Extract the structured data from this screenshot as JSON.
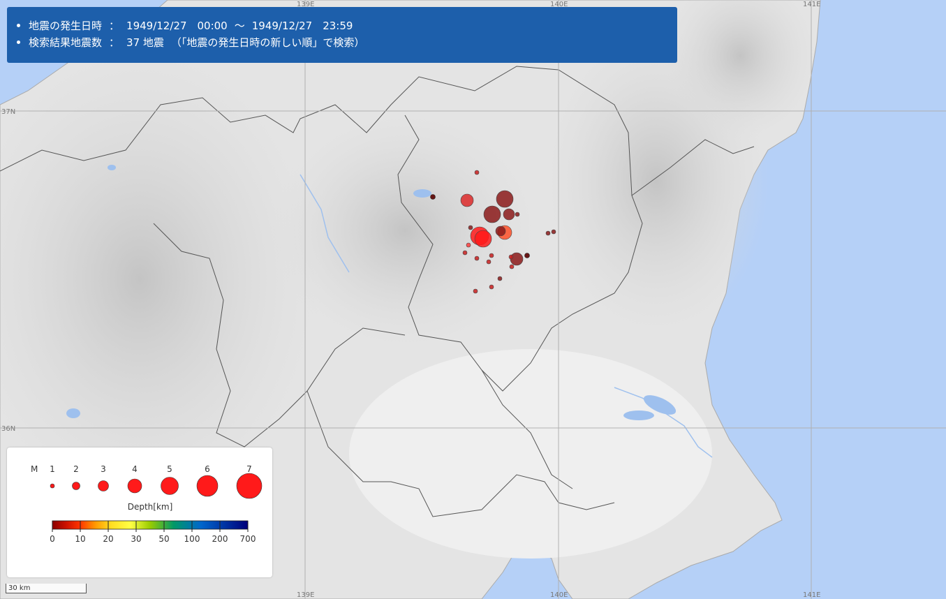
{
  "info": {
    "line1_label": "地震の発生日時",
    "line1_sep": "：",
    "line1_start": "1949/12/27　00:00",
    "line1_tilde": "～",
    "line1_end": "1949/12/27　23:59",
    "line2_label": "検索結果地震数",
    "line2_sep": "：",
    "line2_count": "37 地震",
    "line2_note": "（「地震の発生日時の新しい順」で検索）"
  },
  "grid_labels": {
    "lon_139": "139E",
    "lon_140": "140E",
    "lon_141": "141E",
    "lat_37": "37N",
    "lat_36": "36N"
  },
  "legend": {
    "magnitude_label": "M",
    "magnitudes": [
      "1",
      "2",
      "3",
      "4",
      "5",
      "6",
      "7"
    ],
    "depth_title": "Depth[km]",
    "depth_ticks": [
      "0",
      "10",
      "20",
      "30",
      "50",
      "100",
      "200",
      "700"
    ],
    "depth_colors": [
      "#8b0000",
      "#ff3300",
      "#ff9900",
      "#ffee33",
      "#99cc00",
      "#009966",
      "#0066cc",
      "#00007a"
    ]
  },
  "scale_bar": {
    "label": "30 km"
  },
  "colors": {
    "sea": "#b5d0f7",
    "land": "#e6e6e6",
    "info_panel": "#1d5fab",
    "quake_shallow": "#ff1a1a",
    "quake_mid": "#8b1a1a",
    "quake_deep": "#5a0000"
  }
}
